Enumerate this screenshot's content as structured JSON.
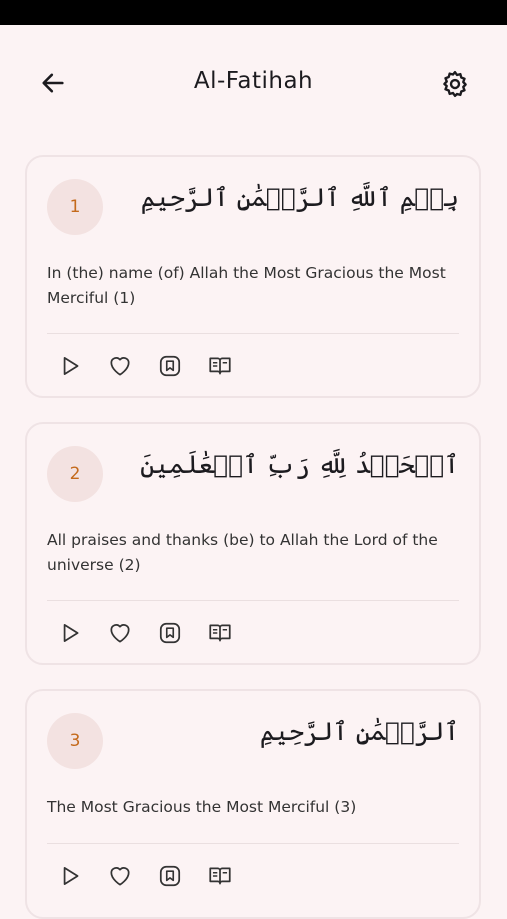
{
  "header": {
    "title": "Al-Fatihah",
    "back_icon": "arrow-left-icon",
    "settings_icon": "gear-icon"
  },
  "colors": {
    "background": "#fcf3f4",
    "badge_bg": "#f3e2e1",
    "badge_text": "#c46a1c",
    "card_border": "#efe3e5"
  },
  "verses": [
    {
      "number": "1",
      "arabic": "بِسۡمِ ٱللَّهِ ٱلرَّحۡمَٰنِ ٱلرَّحِيمِ",
      "translation": "In (the) name (of) Allah the Most Gracious the Most Merciful (1)"
    },
    {
      "number": "2",
      "arabic": "ٱلۡحَمۡدُ لِلَّهِ رَبِّ ٱلۡعَٰلَمِينَ",
      "translation": "All praises and thanks (be) to Allah the Lord of the universe (2)"
    },
    {
      "number": "3",
      "arabic": "ٱلرَّحۡمَٰنِ ٱلرَّحِيمِ",
      "translation": "The Most Gracious the Most Merciful (3)"
    }
  ],
  "actions": [
    "play-icon",
    "heart-icon",
    "bookmark-icon",
    "open-book-icon"
  ]
}
